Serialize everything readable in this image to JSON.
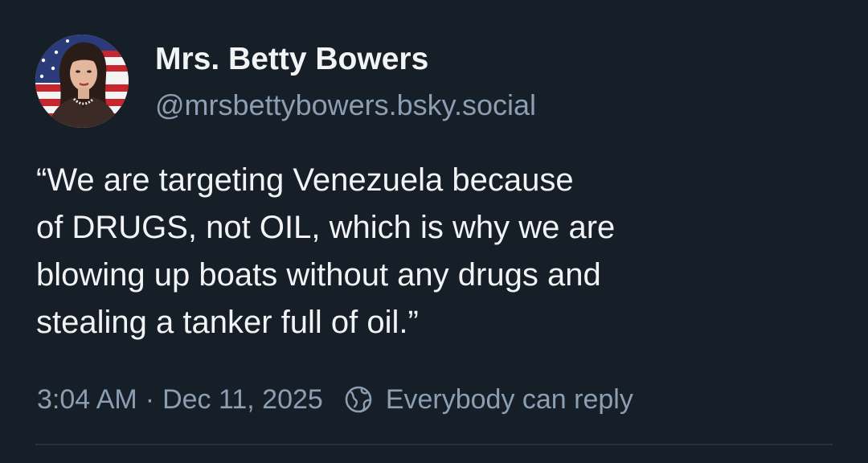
{
  "post": {
    "author": {
      "display_name": "Mrs. Betty Bowers",
      "handle": "@mrsbettybowers.bsky.social",
      "avatar": "avatar-woman-american-flag"
    },
    "text": "“We are targeting Venezuela because\nof DRUGS, not OIL, which is why we are\nblowing up boats without any drugs and\nstealing a tanker full of oil.”",
    "time": "3:04 AM",
    "separator": "·",
    "date": "Dec 11, 2025",
    "reply_setting": {
      "icon": "globe-icon",
      "label": "Everybody can reply"
    }
  },
  "colors": {
    "background": "#161e27",
    "text": "#f1f3f5",
    "muted": "#8c9eb2",
    "divider": "#263241"
  }
}
